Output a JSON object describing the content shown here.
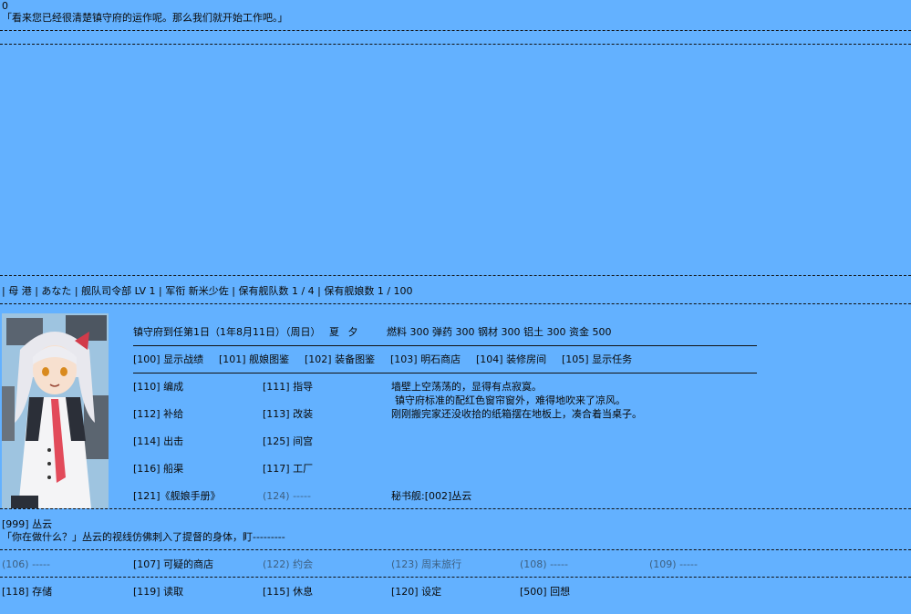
{
  "top": {
    "counter": "0",
    "message": "「看来您已经很清楚镇守府的运作呢。那么我们就开始工作吧。」"
  },
  "status_bar": {
    "location": "| 母 港 |",
    "user": "あなた",
    "hq": "| 舰队司令部 LV 1 |",
    "rank_label": "军衔",
    "rank": "新米少佐",
    "fleets": "| 保有舰队数 1 / 4 |",
    "ships": "保有舰娘数 1 / 100"
  },
  "info_line": {
    "date": "镇守府到任第1日（1年8月11日）（周日）",
    "season": "夏",
    "time": "夕",
    "resources": "燃料 300 弹药 300 钢材 300 铝土 300 资金 500"
  },
  "menu_row1": [
    "[100] 显示战绩",
    "[101] 舰娘图鉴",
    "[102] 装备图鉴",
    "[103] 明石商店",
    "[104] 装修房间",
    "[105] 显示任务"
  ],
  "menu_grid": {
    "c110": "[110] 编成",
    "c111": "[111] 指导",
    "c112": "[112] 补给",
    "c113": "[113] 改装",
    "c114": "[114] 出击",
    "c125": "[125] 间宫",
    "c116": "[116] 船渠",
    "c117": "[117] 工厂",
    "c121": "[121]《舰娘手册》",
    "c124": "(124) -----"
  },
  "description": {
    "line1": "墙壁上空荡荡的，显得有点寂寞。",
    "line2": "镇守府标准的配红色窗帘窗外，难得地吹来了凉风。",
    "line3": "刚刚搬完家还没收拾的纸箱摆在地板上，凑合着当桌子。",
    "secretary": "秘书舰:[002]丛云"
  },
  "dialogue": {
    "speaker": "[999] 丛云",
    "text": "「你在做什么？」丛云的视线仿佛刺入了提督的身体，盯---------"
  },
  "menu_row3": [
    "(106) -----",
    "[107] 可疑的商店",
    "(122) 约会",
    "(123) 周末旅行",
    "(108) -----",
    "(109) -----"
  ],
  "menu_row4": [
    "[118] 存储",
    "[119] 读取",
    "[115] 休息",
    "[120] 设定",
    "[500] 回想"
  ],
  "colors": {
    "background": "#63b1ff",
    "text": "#0a0a0a",
    "disabled": "#3d5f80"
  },
  "icons": {
    "portrait": "ship-girl-portrait"
  }
}
